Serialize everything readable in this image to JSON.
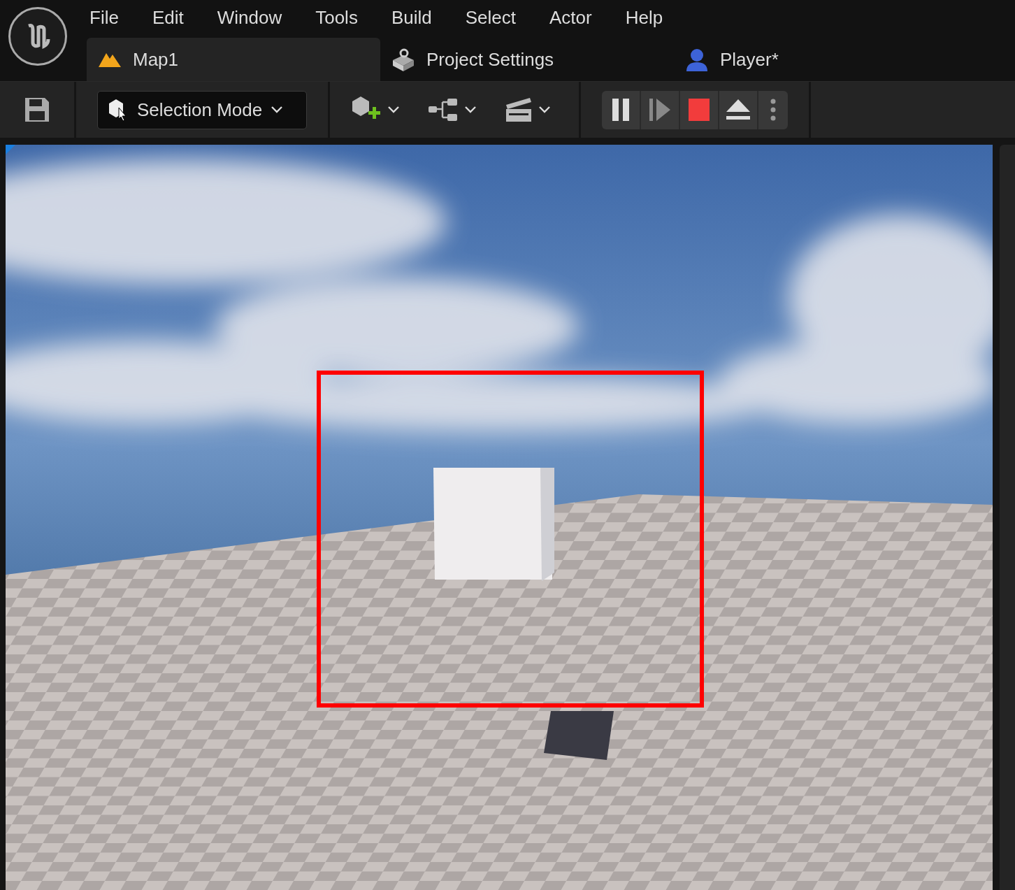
{
  "menu": [
    "File",
    "Edit",
    "Window",
    "Tools",
    "Build",
    "Select",
    "Actor",
    "Help"
  ],
  "tabs": [
    {
      "label": "Map1",
      "kind": "level",
      "selected": true
    },
    {
      "label": "Project Settings",
      "kind": "settings",
      "selected": false
    },
    {
      "label": "Player*",
      "kind": "blueprint",
      "selected": false
    }
  ],
  "toolbar": {
    "mode": "Selection Mode"
  }
}
